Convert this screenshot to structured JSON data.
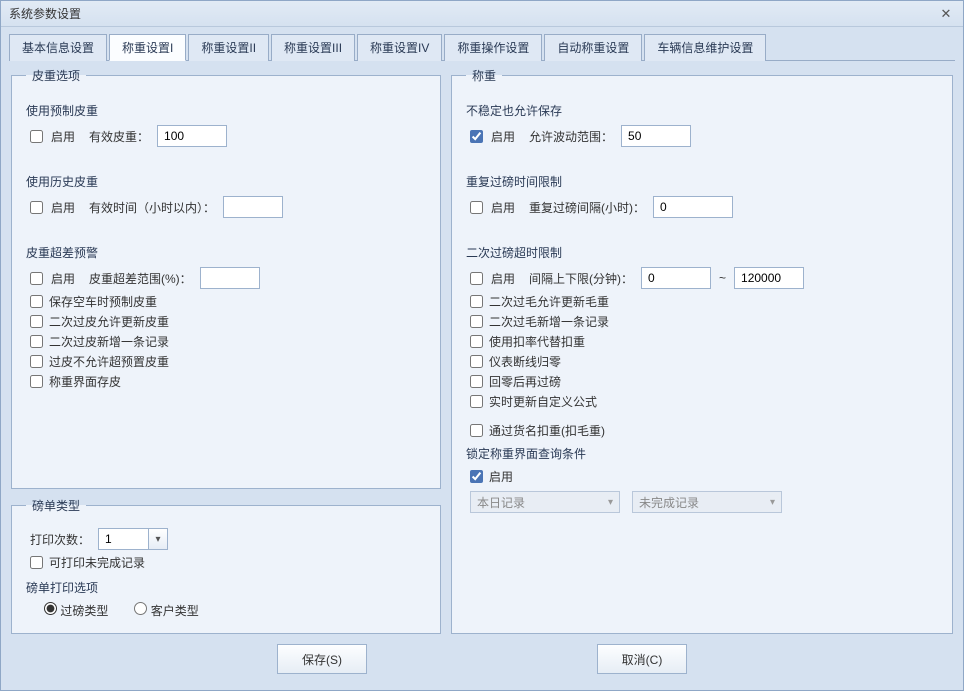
{
  "window": {
    "title": "系统参数设置"
  },
  "tabs": [
    {
      "label": "基本信息设置"
    },
    {
      "label": "称重设置I"
    },
    {
      "label": "称重设置II"
    },
    {
      "label": "称重设置III"
    },
    {
      "label": "称重设置IV"
    },
    {
      "label": "称重操作设置"
    },
    {
      "label": "自动称重设置"
    },
    {
      "label": "车辆信息维护设置"
    }
  ],
  "tare": {
    "legend": "皮重选项",
    "preset": {
      "title": "使用预制皮重",
      "enable_label": "启用",
      "field_label": "有效皮重：",
      "value": "100"
    },
    "history": {
      "title": "使用历史皮重",
      "enable_label": "启用",
      "field_label": "有效时间（小时以内）：",
      "value": ""
    },
    "warn": {
      "title": "皮重超差预警",
      "enable_label": "启用",
      "range_label": "皮重超差范围(%)：",
      "range_value": "",
      "opt1": "保存空车时预制皮重",
      "opt2": "二次过皮允许更新皮重",
      "opt3": "二次过皮新增一条记录",
      "opt4": "过皮不允许超预置皮重",
      "opt5": "称重界面存皮"
    }
  },
  "ticket": {
    "legend": "磅单类型",
    "print_count_label": "打印次数：",
    "print_count_value": "1",
    "print_unfinished": "可打印未完成记录",
    "print_opts_title": "磅单打印选项",
    "radio_weigh": "过磅类型",
    "radio_customer": "客户类型"
  },
  "weigh": {
    "legend": "称重",
    "unstable": {
      "title": "不稳定也允许保存",
      "enable_label": "启用",
      "range_label": "允许波动范围：",
      "value": "50"
    },
    "repeat": {
      "title": "重复过磅时间限制",
      "enable_label": "启用",
      "interval_label": "重复过磅间隔(小时)：",
      "value": "0"
    },
    "overtime": {
      "title": "二次过磅超时限制",
      "enable_label": "启用",
      "range_label": "间隔上下限(分钟)：",
      "lo": "0",
      "tilde": "~",
      "hi": "120000"
    },
    "opts": {
      "o1": "二次过毛允许更新毛重",
      "o2": "二次过毛新增一条记录",
      "o3": "使用扣率代替扣重",
      "o4": "仪表断线归零",
      "o5": "回零后再过磅",
      "o6": "实时更新自定义公式",
      "o7": "通过货名扣重(扣毛重)"
    },
    "lock": {
      "title": "锁定称重界面查询条件",
      "enable_label": "启用",
      "combo1": "本日记录",
      "combo2": "未完成记录"
    }
  },
  "footer": {
    "save": "保存(S)",
    "cancel": "取消(C)"
  }
}
